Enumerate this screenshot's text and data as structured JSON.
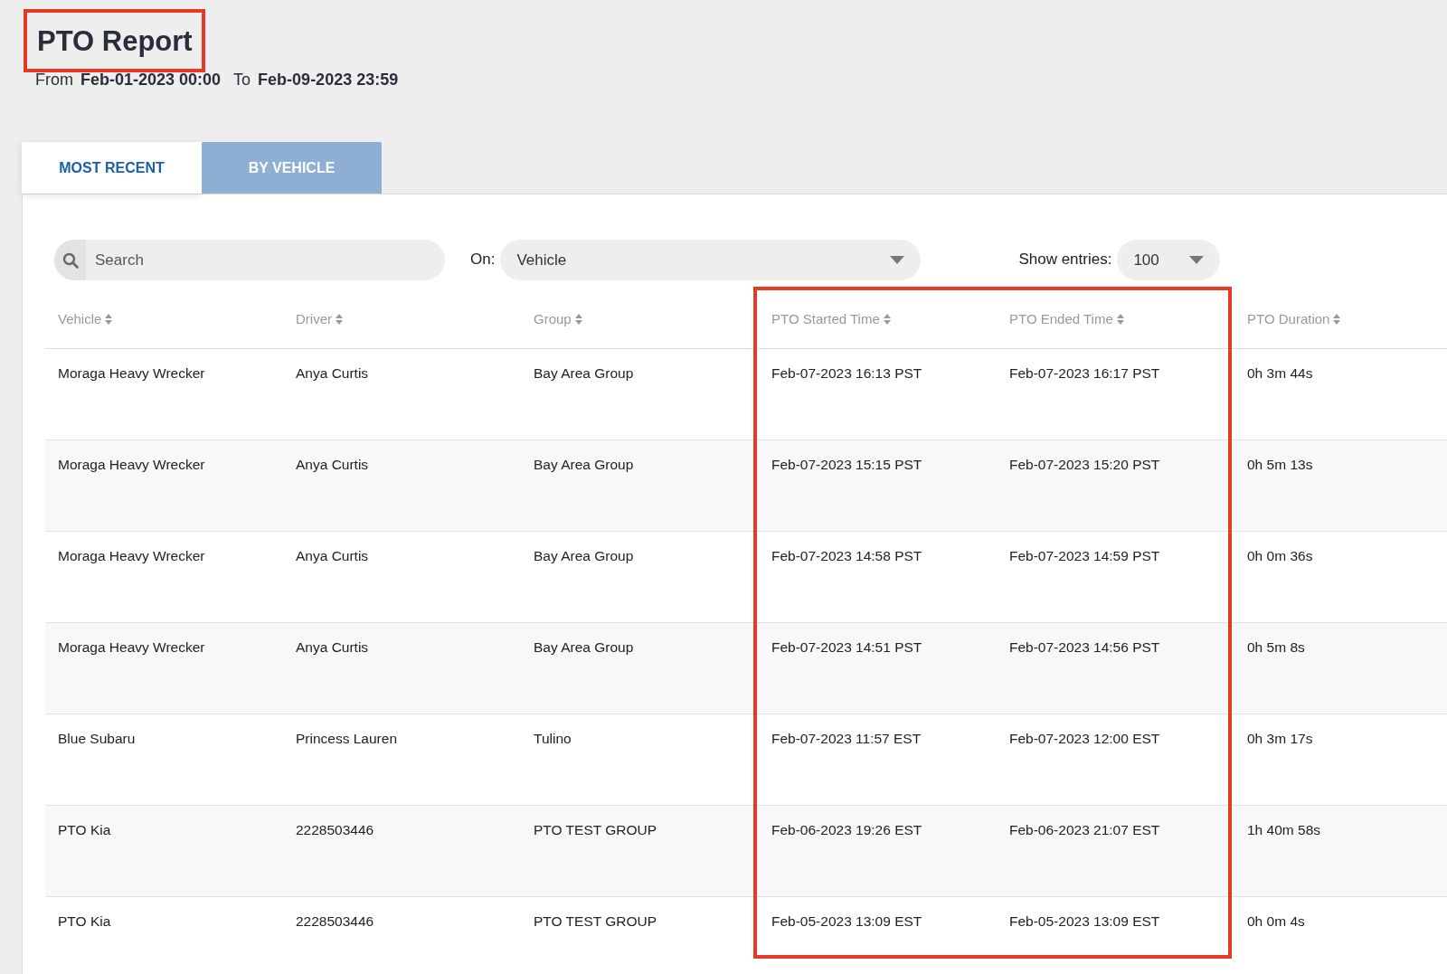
{
  "title": {
    "text": "PTO Report",
    "highlighted": true
  },
  "date_range": {
    "from_label": "From",
    "from": "Feb-01-2023 00:00",
    "to_label": "To",
    "to": "Feb-09-2023 23:59"
  },
  "tabs": [
    {
      "label": "MOST RECENT",
      "selected": true
    },
    {
      "label": "BY VEHICLE",
      "selected": false
    }
  ],
  "search": {
    "placeholder": "Search"
  },
  "on_filter": {
    "label": "On:",
    "value": "Vehicle"
  },
  "show_entries": {
    "label": "Show entries:",
    "value": "100"
  },
  "table": {
    "columns": [
      {
        "label": "Vehicle",
        "highlighted": false
      },
      {
        "label": "Driver",
        "highlighted": false
      },
      {
        "label": "Group",
        "highlighted": false
      },
      {
        "label": "PTO Started Time",
        "highlighted": true
      },
      {
        "label": "PTO Ended Time",
        "highlighted": true
      },
      {
        "label": "PTO Duration",
        "highlighted": false
      }
    ],
    "rows": [
      [
        "Moraga Heavy Wrecker",
        "Anya Curtis",
        "Bay Area Group",
        "Feb-07-2023 16:13 PST",
        "Feb-07-2023 16:17 PST",
        "0h 3m 44s"
      ],
      [
        "Moraga Heavy Wrecker",
        "Anya Curtis",
        "Bay Area Group",
        "Feb-07-2023 15:15 PST",
        "Feb-07-2023 15:20 PST",
        "0h 5m 13s"
      ],
      [
        "Moraga Heavy Wrecker",
        "Anya Curtis",
        "Bay Area Group",
        "Feb-07-2023 14:58 PST",
        "Feb-07-2023 14:59 PST",
        "0h 0m 36s"
      ],
      [
        "Moraga Heavy Wrecker",
        "Anya Curtis",
        "Bay Area Group",
        "Feb-07-2023 14:51 PST",
        "Feb-07-2023 14:56 PST",
        "0h 5m 8s"
      ],
      [
        "Blue Subaru",
        "Princess Lauren",
        "Tulino",
        "Feb-07-2023 11:57 EST",
        "Feb-07-2023 12:00 EST",
        "0h 3m 17s"
      ],
      [
        "PTO Kia",
        "2228503446",
        "PTO TEST GROUP",
        "Feb-06-2023 19:26 EST",
        "Feb-06-2023 21:07 EST",
        "1h 40m 58s"
      ],
      [
        "PTO Kia",
        "2228503446",
        "PTO TEST GROUP",
        "Feb-05-2023 13:09 EST",
        "Feb-05-2023 13:09 EST",
        "0h 0m 4s"
      ]
    ]
  }
}
